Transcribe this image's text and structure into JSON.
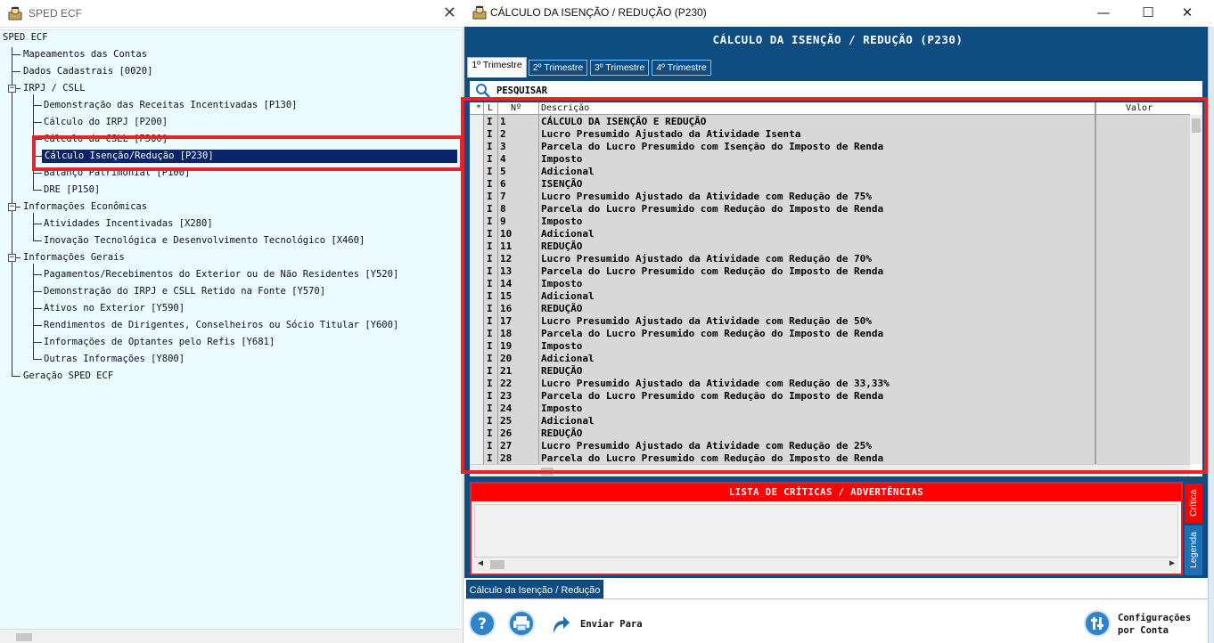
{
  "left_window": {
    "title": "SPED ECF",
    "close_glyph": "✕",
    "tree": [
      {
        "label": "SPED ECF"
      },
      {
        "label": "Mapeamentos das Contas"
      },
      {
        "label": "Dados Cadastrais [0020]"
      },
      {
        "label": "IRPJ / CSLL"
      },
      {
        "label": "Demonstração das Receitas Incentivadas [P130]"
      },
      {
        "label": "Cálculo do IRPJ [P200]"
      },
      {
        "label": "Cálculo da CSLL [P300]"
      },
      {
        "label": "Cálculo Isenção/Redução [P230]"
      },
      {
        "label": "Balanço Patrimonial [P100]"
      },
      {
        "label": "DRE [P150]"
      },
      {
        "label": "Informações Econômicas"
      },
      {
        "label": "Atividades Incentivadas [X280]"
      },
      {
        "label": "Inovação Tecnológica e Desenvolvimento Tecnológico [X460]"
      },
      {
        "label": "Informações Gerais"
      },
      {
        "label": "Pagamentos/Recebimentos do Exterior ou de Não Residentes [Y520]"
      },
      {
        "label": "Demonstração do IRPJ e CSLL Retido na Fonte [Y570]"
      },
      {
        "label": "Ativos no Exterior [Y590]"
      },
      {
        "label": "Rendimentos de Dirigentes, Conselheiros ou Sócio Titular [Y600]"
      },
      {
        "label": "Informações de Optantes pelo Refis [Y681]"
      },
      {
        "label": "Outras Informações [Y800]"
      },
      {
        "label": "Geração SPED ECF"
      }
    ],
    "expander_minus": "−"
  },
  "right_window": {
    "title": "CÁLCULO DA ISENÇÃO / REDUÇÃO (P230)",
    "minimize_glyph": "—",
    "maximize_glyph": "☐",
    "close_glyph": "✕",
    "header": "CÁLCULO DA ISENÇÃO / REDUÇÃO (P230)",
    "tabs": [
      "1º Trimestre",
      "2º Trimestre",
      "3º Trimestre",
      "4º Trimestre"
    ],
    "search_label": "PESQUISAR",
    "columns": {
      "star": "*",
      "l": "L",
      "num": "Nº",
      "desc": "Descrição",
      "valor": "Valor"
    },
    "rows": [
      {
        "l": "I",
        "n": "1",
        "d": "CÁLCULO DA ISENÇÃO E REDUÇÃO"
      },
      {
        "l": "I",
        "n": "2",
        "d": "Lucro Presumido Ajustado da Atividade Isenta"
      },
      {
        "l": "I",
        "n": "3",
        "d": "Parcela do Lucro Presumido com Isenção do Imposto de Renda"
      },
      {
        "l": "I",
        "n": "4",
        "d": "Imposto"
      },
      {
        "l": "I",
        "n": "5",
        "d": "Adicional"
      },
      {
        "l": "I",
        "n": "6",
        "d": "ISENÇÃO"
      },
      {
        "l": "I",
        "n": "7",
        "d": "Lucro Presumido Ajustado da Atividade com Redução de 75%"
      },
      {
        "l": "I",
        "n": "8",
        "d": "Parcela do Lucro Presumido com Redução do Imposto de Renda"
      },
      {
        "l": "I",
        "n": "9",
        "d": "Imposto"
      },
      {
        "l": "I",
        "n": "10",
        "d": "Adicional"
      },
      {
        "l": "I",
        "n": "11",
        "d": "REDUÇÃO"
      },
      {
        "l": "I",
        "n": "12",
        "d": "Lucro Presumido Ajustado da Atividade com Redução de 70%"
      },
      {
        "l": "I",
        "n": "13",
        "d": "Parcela do Lucro Presumido com Redução do Imposto de Renda"
      },
      {
        "l": "I",
        "n": "14",
        "d": "Imposto"
      },
      {
        "l": "I",
        "n": "15",
        "d": "Adicional"
      },
      {
        "l": "I",
        "n": "16",
        "d": "REDUÇÃO"
      },
      {
        "l": "I",
        "n": "17",
        "d": "Lucro Presumido Ajustado da Atividade com Redução de 50%"
      },
      {
        "l": "I",
        "n": "18",
        "d": "Parcela do Lucro Presumido com Redução do Imposto de Renda"
      },
      {
        "l": "I",
        "n": "19",
        "d": "Imposto"
      },
      {
        "l": "I",
        "n": "20",
        "d": "Adicional"
      },
      {
        "l": "I",
        "n": "21",
        "d": "REDUÇÃO"
      },
      {
        "l": "I",
        "n": "22",
        "d": "Lucro Presumido Ajustado da Atividade com Redução de 33,33%"
      },
      {
        "l": "I",
        "n": "23",
        "d": "Parcela do Lucro Presumido com Redução do Imposto de Renda"
      },
      {
        "l": "I",
        "n": "24",
        "d": "Imposto"
      },
      {
        "l": "I",
        "n": "25",
        "d": "Adicional"
      },
      {
        "l": "I",
        "n": "26",
        "d": "REDUÇÃO"
      },
      {
        "l": "I",
        "n": "27",
        "d": "Lucro Presumido Ajustado da Atividade com Redução de 25%"
      },
      {
        "l": "I",
        "n": "28",
        "d": "Parcela do Lucro Presumido com Redução do Imposto de Renda"
      }
    ],
    "critics_header": "LISTA DE CRÍTICAS / ADVERTÊNCIAS",
    "side_tab_critica": "Crítica",
    "side_tab_legenda": "Legenda",
    "bottom_tab": "Cálculo da Isenção / Redução",
    "send_label": "Enviar Para",
    "config_label_1": "Configurações",
    "config_label_2": "por Conta",
    "colors": {
      "navy": "#0f4c82",
      "red": "#ff0000",
      "highlight": "#e3242b",
      "tree_bg": "#ecfbff",
      "button_blue": "#2f83c9"
    }
  }
}
